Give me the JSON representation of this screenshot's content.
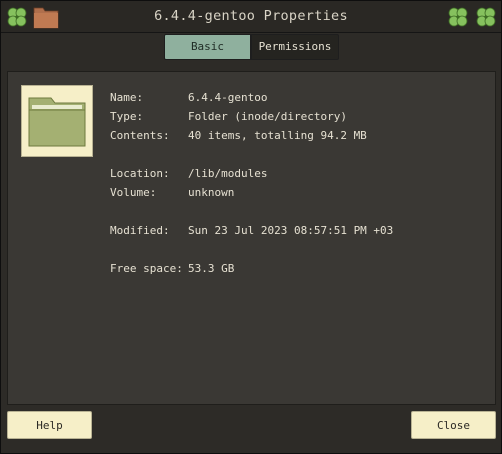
{
  "window": {
    "title": "6.4.4-gentoo Properties"
  },
  "tabs": [
    {
      "label": "Basic"
    },
    {
      "label": "Permissions"
    }
  ],
  "properties": {
    "name": {
      "label": "Name:",
      "value": "6.4.4-gentoo"
    },
    "type": {
      "label": "Type:",
      "value": "Folder (inode/directory)"
    },
    "contents": {
      "label": "Contents:",
      "value": "40 items, totalling 94.2 MB"
    },
    "location": {
      "label": "Location:",
      "value": "/lib/modules"
    },
    "volume": {
      "label": "Volume:",
      "value": "unknown"
    },
    "modified": {
      "label": "Modified:",
      "value": "Sun 23 Jul 2023 08:57:51 PM +03"
    },
    "free_space": {
      "label": "Free space:",
      "value": "53.3 GB"
    }
  },
  "buttons": {
    "help": "Help",
    "close": "Close"
  },
  "icons": {
    "folder": "folder-icon",
    "clover": "clover-icon",
    "colors": {
      "folder_green": "#a4b072",
      "tab_active": "#8fb09e",
      "clover": "#86c15e"
    }
  }
}
